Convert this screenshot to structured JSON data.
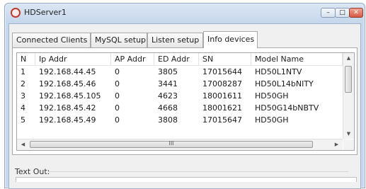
{
  "window": {
    "title": "HDServer1"
  },
  "controls": {
    "minimize": "–",
    "maximize": "□",
    "close": "✕"
  },
  "tabs": [
    {
      "label": "Connected Clients",
      "active": false
    },
    {
      "label": "MySQL setup",
      "active": false
    },
    {
      "label": "Listen setup",
      "active": false
    },
    {
      "label": "Info devices",
      "active": true
    }
  ],
  "table": {
    "columns": [
      "N",
      "Ip Addr",
      "AP Addr",
      "ED Addr",
      "SN",
      "Model Name"
    ],
    "rows": [
      [
        "1",
        "192.168.44.45",
        "0",
        "3805",
        "17015644",
        "HD50L1NTV"
      ],
      [
        "2",
        "192.168.45.46",
        "0",
        "3441",
        "17008287",
        "HD50L14bNITY"
      ],
      [
        "3",
        "192.168.45.105",
        "0",
        "4623",
        "18001611",
        "HD50GH"
      ],
      [
        "4",
        "192.168.45.42",
        "0",
        "4668",
        "18001621",
        "HD50G14bNBTV"
      ],
      [
        "5",
        "192.168.45.49",
        "0",
        "3808",
        "17015647",
        "HD50GH"
      ]
    ]
  },
  "scroll": {
    "up": "▲",
    "down": "▼",
    "left": "◀",
    "right": "▶",
    "grip": "III"
  },
  "text_out": {
    "label": "Text Out:"
  }
}
